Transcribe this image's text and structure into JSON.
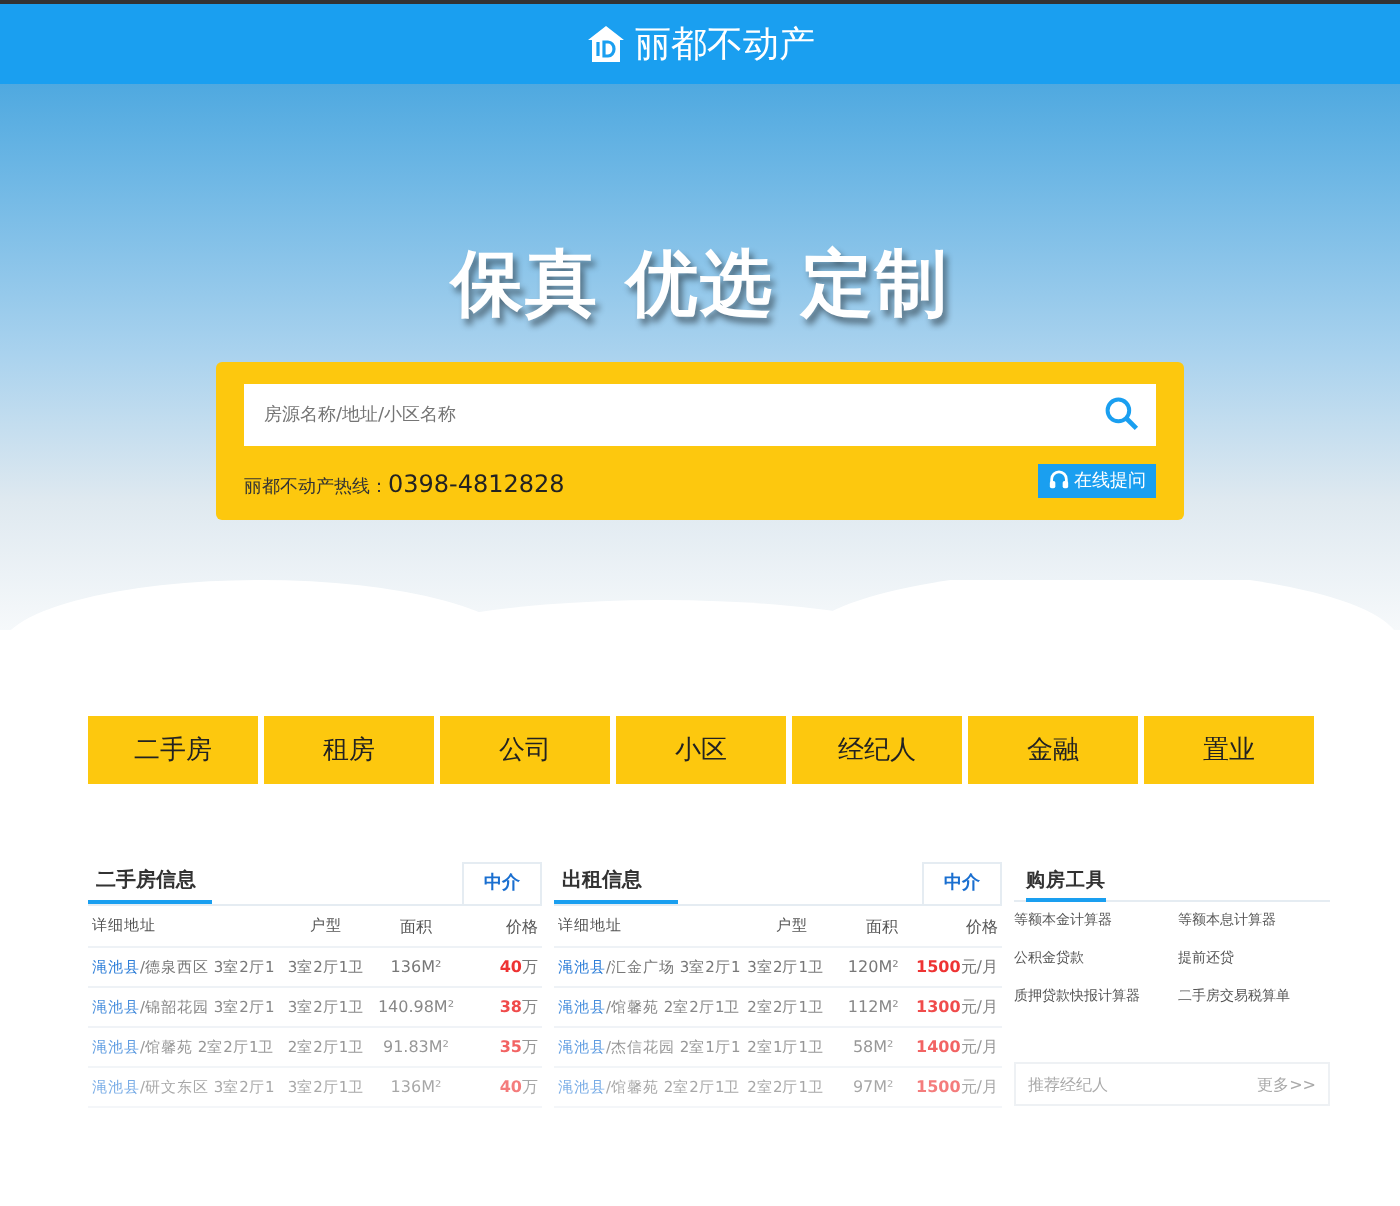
{
  "header": {
    "logo_text": "丽都不动产"
  },
  "hero": {
    "slogan": "保真 优选 定制",
    "search": {
      "placeholder": "房源名称/地址/小区名称"
    },
    "hotline_label": "丽都不动产热线：",
    "hotline": "0398-4812828",
    "ask_button": "在线提问"
  },
  "nav": [
    "二手房",
    "租房",
    "公司",
    "小区",
    "经纪人",
    "金融",
    "置业"
  ],
  "panels": [
    {
      "title": "二手房信息",
      "tab": "中介",
      "columns": [
        "详细地址",
        "户型",
        "面积",
        "价格"
      ],
      "rows": [
        {
          "county": "渑池县",
          "address": "/德泉西区 3室2厅1",
          "layout": "3室2厅1卫",
          "area": "136M²",
          "price": "40",
          "unit": "万"
        },
        {
          "county": "渑池县",
          "address": "/锦韶花园 3室2厅1",
          "layout": "3室2厅1卫",
          "area": "140.98M²",
          "price": "38",
          "unit": "万"
        },
        {
          "county": "渑池县",
          "address": "/馆馨苑 2室2厅1卫",
          "layout": "2室2厅1卫",
          "area": "91.83M²",
          "price": "35",
          "unit": "万"
        },
        {
          "county": "渑池县",
          "address": "/研文东区 3室2厅1",
          "layout": "3室2厅1卫",
          "area": "136M²",
          "price": "40",
          "unit": "万"
        }
      ]
    },
    {
      "title": "出租信息",
      "tab": "中介",
      "columns": [
        "详细地址",
        "户型",
        "面积",
        "价格"
      ],
      "rows": [
        {
          "county": "渑池县",
          "address": "/汇金广场 3室2厅1",
          "layout": "3室2厅1卫",
          "area": "120M²",
          "price": "1500",
          "unit": "元/月"
        },
        {
          "county": "渑池县",
          "address": "/馆馨苑 2室2厅1卫",
          "layout": "2室2厅1卫",
          "area": "112M²",
          "price": "1300",
          "unit": "元/月"
        },
        {
          "county": "渑池县",
          "address": "/杰信花园 2室1厅1",
          "layout": "2室1厅1卫",
          "area": "58M²",
          "price": "1400",
          "unit": "元/月"
        },
        {
          "county": "渑池县",
          "address": "/馆馨苑 2室2厅1卫",
          "layout": "2室2厅1卫",
          "area": "97M²",
          "price": "1500",
          "unit": "元/月"
        }
      ]
    }
  ],
  "tools": {
    "title": "购房工具",
    "links": [
      "等额本金计算器",
      "等额本息计算器",
      "公积金贷款",
      "提前还贷",
      "质押贷款快报计算器",
      "二手房交易税算单"
    ]
  },
  "agents": {
    "title": "推荐经纪人",
    "more": "更多>>"
  }
}
